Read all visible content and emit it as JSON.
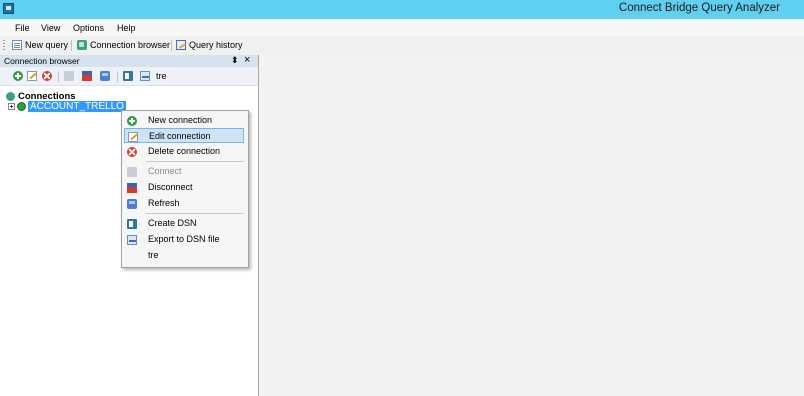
{
  "window": {
    "title": "Connect Bridge Query Analyzer"
  },
  "menu": {
    "items": [
      "File",
      "View",
      "Options",
      "Help"
    ]
  },
  "toolbar": {
    "new_query": "New query",
    "connection_browser": "Connection browser",
    "query_history": "Query history"
  },
  "panel": {
    "title": "Connection browser",
    "pin_glyph": "⬍",
    "close_glyph": "×",
    "toolbar_text": "tre"
  },
  "tree": {
    "root_label": "Connections",
    "child_label": "ACCOUNT_TRELLO"
  },
  "context_menu": {
    "items": [
      {
        "label": "New connection",
        "icon": "plus-icon"
      },
      {
        "label": "Edit connection",
        "icon": "edit-icon",
        "highlighted": true
      },
      {
        "label": "Delete connection",
        "icon": "delete-icon"
      },
      {
        "label": "Connect",
        "icon": "connect-icon",
        "disabled": true
      },
      {
        "label": "Disconnect",
        "icon": "disconnect-icon"
      },
      {
        "label": "Refresh",
        "icon": "refresh-icon"
      },
      {
        "label": "Create DSN",
        "icon": "create-dsn-icon"
      },
      {
        "label": "Export to DSN file",
        "icon": "export-dsn-icon"
      },
      {
        "label": "tre",
        "icon": ""
      }
    ]
  },
  "colors": {
    "title_bar": "#5fd0ef",
    "selection": "#3399ff",
    "menu_highlight": "#cde4f7"
  }
}
